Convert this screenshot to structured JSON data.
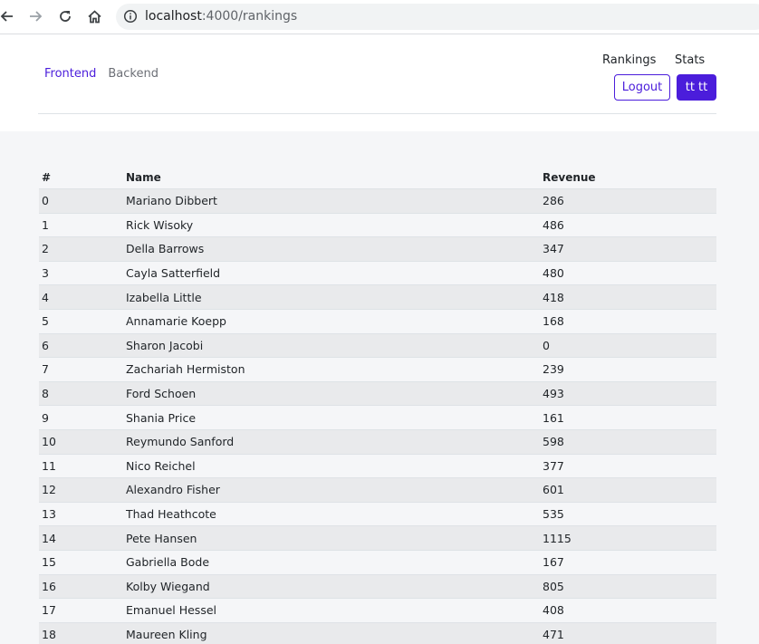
{
  "browser": {
    "url_host": "localhost",
    "url_rest": ":4000/rankings"
  },
  "header": {
    "tabs": [
      {
        "label": "Frontend",
        "active": true
      },
      {
        "label": "Backend",
        "active": false
      }
    ],
    "links": {
      "rankings": "Rankings",
      "stats": "Stats"
    },
    "logout_label": "Logout",
    "user_label": "tt tt"
  },
  "table": {
    "headers": {
      "index": "#",
      "name": "Name",
      "revenue": "Revenue"
    },
    "rows": [
      {
        "index": "0",
        "name": "Mariano Dibbert",
        "revenue": "286"
      },
      {
        "index": "1",
        "name": "Rick Wisoky",
        "revenue": "486"
      },
      {
        "index": "2",
        "name": "Della Barrows",
        "revenue": "347"
      },
      {
        "index": "3",
        "name": "Cayla Satterfield",
        "revenue": "480"
      },
      {
        "index": "4",
        "name": "Izabella Little",
        "revenue": "418"
      },
      {
        "index": "5",
        "name": "Annamarie Koepp",
        "revenue": "168"
      },
      {
        "index": "6",
        "name": "Sharon Jacobi",
        "revenue": "0"
      },
      {
        "index": "7",
        "name": "Zachariah Hermiston",
        "revenue": "239"
      },
      {
        "index": "8",
        "name": "Ford Schoen",
        "revenue": "493"
      },
      {
        "index": "9",
        "name": "Shania Price",
        "revenue": "161"
      },
      {
        "index": "10",
        "name": "Reymundo Sanford",
        "revenue": "598"
      },
      {
        "index": "11",
        "name": "Nico Reichel",
        "revenue": "377"
      },
      {
        "index": "12",
        "name": "Alexandro Fisher",
        "revenue": "601"
      },
      {
        "index": "13",
        "name": "Thad Heathcote",
        "revenue": "535"
      },
      {
        "index": "14",
        "name": "Pete Hansen",
        "revenue": "1115"
      },
      {
        "index": "15",
        "name": "Gabriella Bode",
        "revenue": "167"
      },
      {
        "index": "16",
        "name": "Kolby Wiegand",
        "revenue": "805"
      },
      {
        "index": "17",
        "name": "Emanuel Hessel",
        "revenue": "408"
      },
      {
        "index": "18",
        "name": "Maureen Kling",
        "revenue": "471"
      }
    ]
  },
  "colors": {
    "accent": "#4b1ddb",
    "page_bg": "#f5f6f8",
    "row_stripe": "#e9eaec"
  },
  "icons": [
    "back-arrow-icon",
    "forward-arrow-icon",
    "reload-icon",
    "home-icon",
    "info-icon"
  ]
}
